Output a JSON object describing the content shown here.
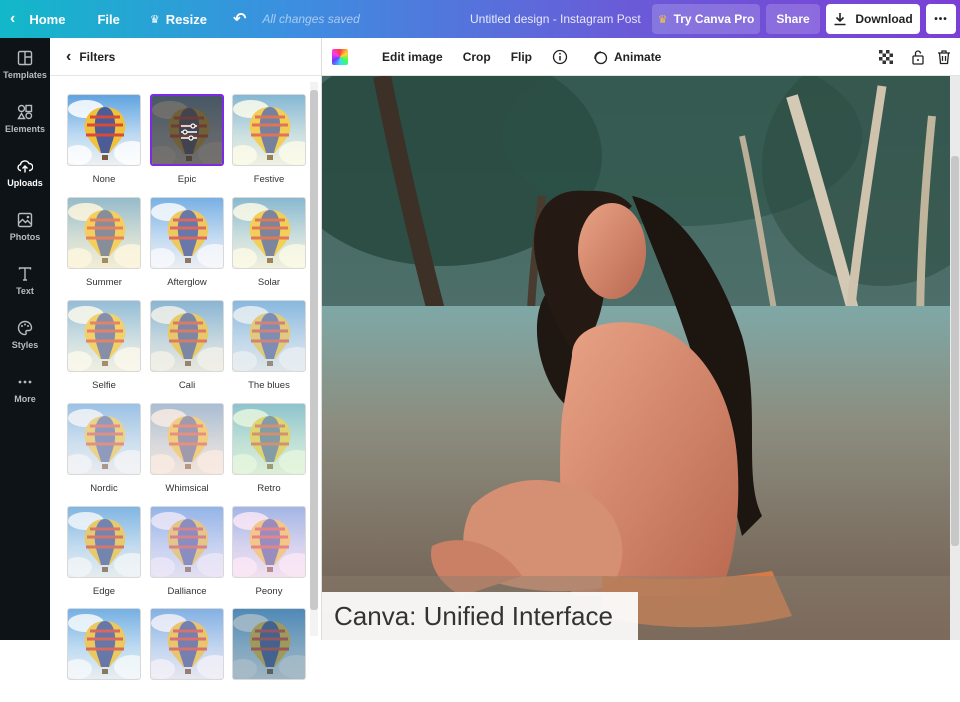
{
  "topbar": {
    "home_label": "Home",
    "file_label": "File",
    "resize_label": "Resize",
    "saved_status": "All changes saved",
    "design_title": "Untitled design - Instagram Post",
    "pro_label": "Try Canva Pro",
    "share_label": "Share",
    "download_label": "Download",
    "more_label": "•••"
  },
  "rail": {
    "items": [
      {
        "label": "Templates",
        "icon": "templates-icon"
      },
      {
        "label": "Elements",
        "icon": "elements-icon"
      },
      {
        "label": "Uploads",
        "icon": "uploads-icon"
      },
      {
        "label": "Photos",
        "icon": "photos-icon"
      },
      {
        "label": "Text",
        "icon": "text-icon"
      },
      {
        "label": "Styles",
        "icon": "styles-icon"
      },
      {
        "label": "More",
        "icon": "more-icon"
      }
    ]
  },
  "panel": {
    "title": "Filters",
    "filters": [
      {
        "label": "None",
        "tint": "#ffffff",
        "alpha": 0.0
      },
      {
        "label": "Epic",
        "tint": "#3f3a36",
        "alpha": 0.72
      },
      {
        "label": "Festive",
        "tint": "#f7f3b0",
        "alpha": 0.25
      },
      {
        "label": "Summer",
        "tint": "#fbe7a0",
        "alpha": 0.35
      },
      {
        "label": "Afterglow",
        "tint": "#dfe6f3",
        "alpha": 0.2
      },
      {
        "label": "Solar",
        "tint": "#f9f1a8",
        "alpha": 0.28
      },
      {
        "label": "Selfie",
        "tint": "#f6edc6",
        "alpha": 0.35
      },
      {
        "label": "Cali",
        "tint": "#d9d6bd",
        "alpha": 0.35
      },
      {
        "label": "The blues",
        "tint": "#c9d8df",
        "alpha": 0.4
      },
      {
        "label": "Nordic",
        "tint": "#e5e7ea",
        "alpha": 0.45
      },
      {
        "label": "Whimsical",
        "tint": "#f3d8c6",
        "alpha": 0.5
      },
      {
        "label": "Retro",
        "tint": "#c8ecb5",
        "alpha": 0.45
      },
      {
        "label": "Edge",
        "tint": "#cfe0e8",
        "alpha": 0.3
      },
      {
        "label": "Dalliance",
        "tint": "#d4c9ef",
        "alpha": 0.45
      },
      {
        "label": "Peony",
        "tint": "#f7cdec",
        "alpha": 0.45
      },
      {
        "label": "",
        "tint": "#d0e8f0",
        "alpha": 0.2
      },
      {
        "label": "",
        "tint": "#d6d0ea",
        "alpha": 0.3
      },
      {
        "label": "",
        "tint": "#3c6a85",
        "alpha": 0.45
      }
    ],
    "selected": "Epic"
  },
  "toolbar": {
    "edit_image_label": "Edit image",
    "crop_label": "Crop",
    "flip_label": "Flip",
    "animate_label": "Animate"
  },
  "canvas": {
    "caption": "Canva: Unified Interface"
  },
  "colors": {
    "accent": "#7d2ae8",
    "rail_bg": "#0e1318"
  }
}
